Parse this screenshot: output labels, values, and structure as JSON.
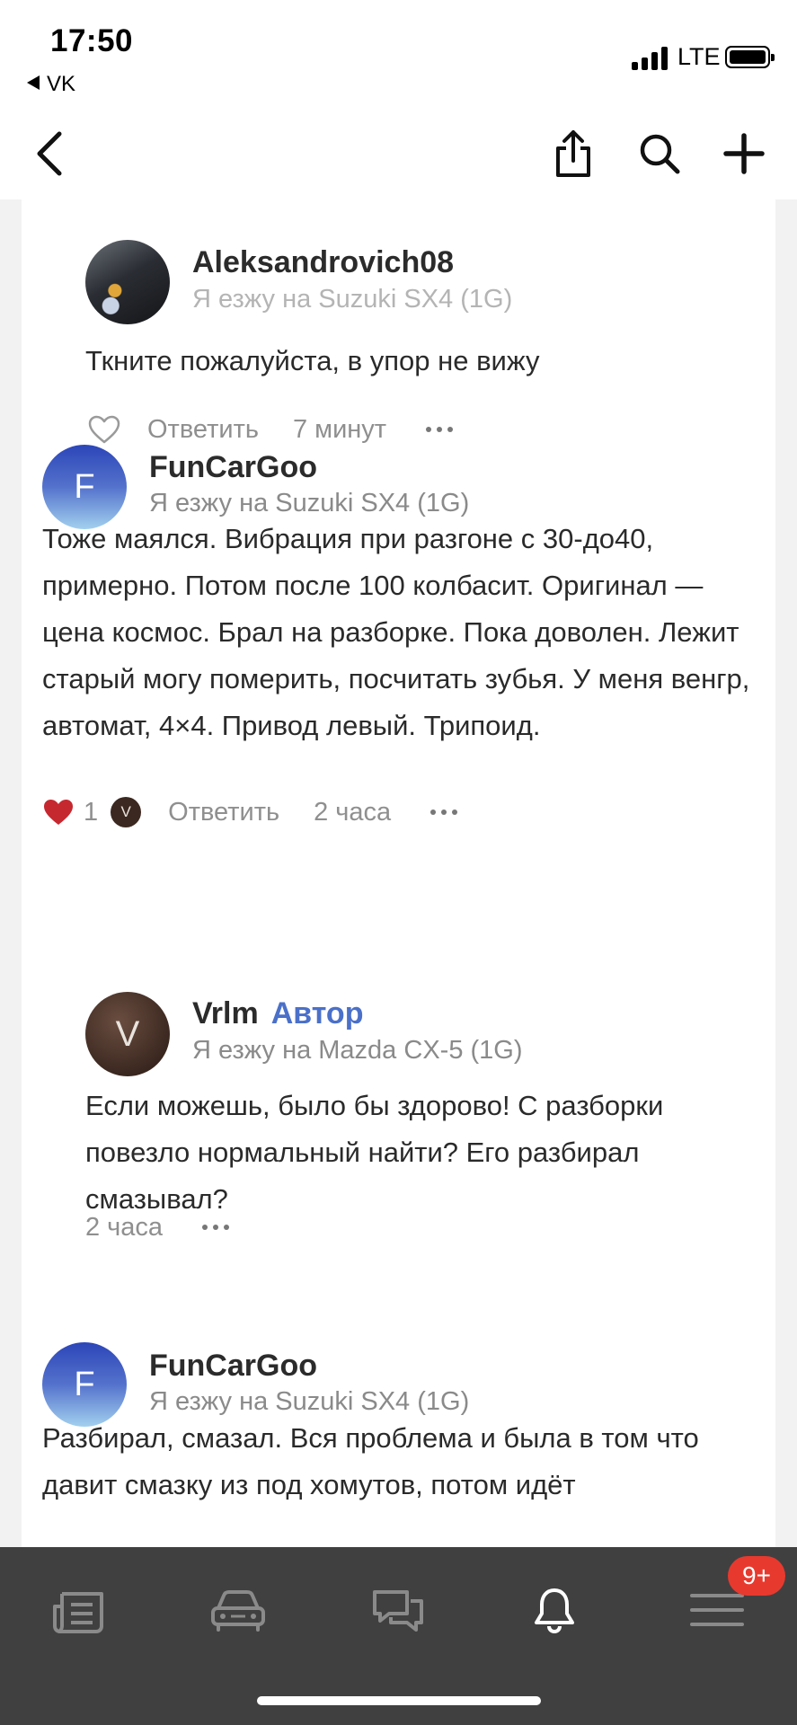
{
  "status": {
    "time": "17:50",
    "back_app": "VK",
    "network": "LTE"
  },
  "comments": [
    {
      "username": "Aleksandrovich08",
      "car": "Я езжу на Suzuki SX4 (1G)",
      "text": "Ткните пожалуйста, в упор не вижу",
      "reply_label": "Ответить",
      "time": "7 минут"
    },
    {
      "username": "FunCarGoo",
      "avatar_letter": "F",
      "car": "Я езжу на Suzuki SX4 (1G)",
      "text": "Тоже маялся. Вибрация при разгоне с 30-до40, примерно. Потом после 100 колбасит. Оригинал — цена космос. Брал на разборке. Пока доволен. Лежит старый могу померить, посчитать зубья. У меня венгр, автомат, 4×4. Привод левый. Трипоид.",
      "likes": "1",
      "liker_letter": "V",
      "reply_label": "Ответить",
      "time": "2 часа"
    },
    {
      "username": "Vrlm",
      "badge": "Автор",
      "avatar_letter": "V",
      "car": "Я езжу на Mazda CX-5 (1G)",
      "text": "Если можешь, было бы здорово! С разборки повезло нормальный найти? Его разбирал смазывал?",
      "time": "2 часа"
    },
    {
      "username": "FunCarGoo",
      "avatar_letter": "F",
      "car": "Я езжу на Suzuki SX4 (1G)",
      "text": "Разбирал, смазал. Вся проблема и была в том что давит смазку из под хомутов, потом идёт"
    }
  ],
  "tabbar": {
    "badge": "9+"
  }
}
